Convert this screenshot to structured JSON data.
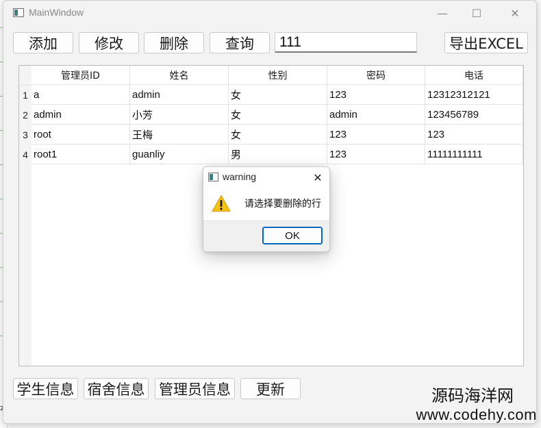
{
  "window": {
    "title": "MainWindow",
    "controls": {
      "minimize": "—",
      "maximize": "☐",
      "close": "✕"
    }
  },
  "toolbar": {
    "add_label": "添加",
    "edit_label": "修改",
    "delete_label": "删除",
    "query_label": "查询",
    "query_value": "111",
    "export_label": "导出EXCEL"
  },
  "table": {
    "columns": [
      "管理员ID",
      "姓名",
      "性别",
      "密码",
      "电话"
    ],
    "row_numbers": [
      "1",
      "2",
      "3",
      "4"
    ],
    "rows": [
      [
        "a",
        "admin",
        "女",
        "123",
        "12312312121"
      ],
      [
        "admin",
        "小芳",
        "女",
        "admin",
        "123456789"
      ],
      [
        "root",
        "王梅",
        "女",
        "123",
        "123"
      ],
      [
        "root1",
        "guanliy",
        "男",
        "123",
        "11111111111"
      ]
    ]
  },
  "bottom_nav": {
    "student_info": "学生信息",
    "dorm_info": "宿舍信息",
    "admin_info": "管理员信息",
    "refresh": "更新"
  },
  "dialog": {
    "title": "warning",
    "close": "✕",
    "message": "请选择要删除的行",
    "ok_label": "OK",
    "icon": "warning-icon"
  },
  "watermark": {
    "line1": "源码海洋网",
    "line2": "www.codehy.com"
  },
  "background": {
    "stub_text": "本"
  },
  "colors": {
    "accent": "#0067c0",
    "warning_yellow": "#f5c211"
  }
}
